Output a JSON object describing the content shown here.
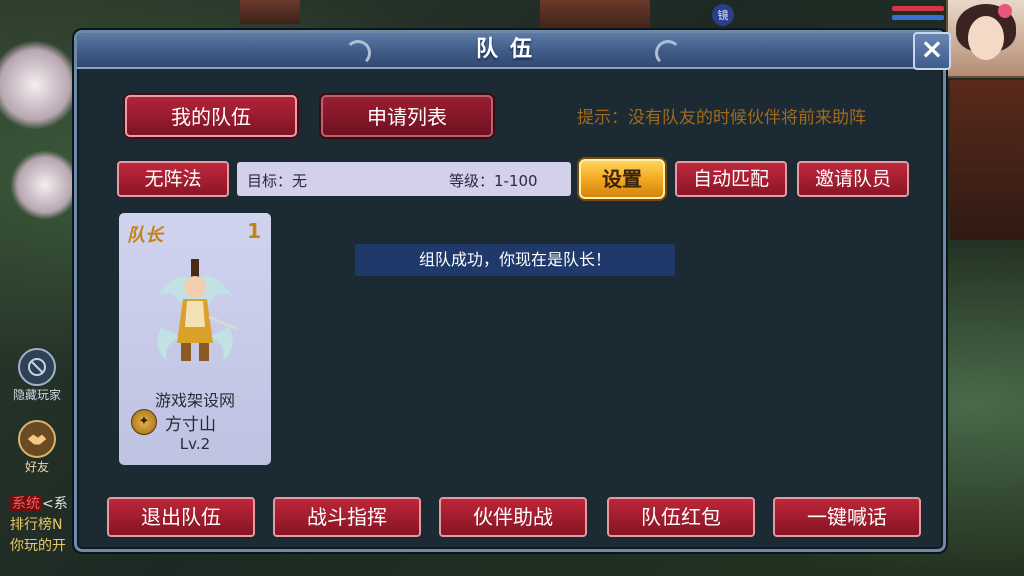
{
  "dialog": {
    "title": "队伍"
  },
  "tabs": [
    {
      "label": "我的队伍",
      "active": true
    },
    {
      "label": "申请列表",
      "active": false
    }
  ],
  "hint": "提示：没有队友的时候伙伴将前来助阵",
  "toolbar": {
    "formation": "无阵法",
    "target": "目标：无",
    "level": "等级：1-100",
    "settings": "设置",
    "auto_match": "自动匹配",
    "invite": "邀请队员"
  },
  "member": {
    "role": "队长",
    "slot": "1",
    "name": "游戏架设网",
    "school": "方寸山",
    "level": "Lv.2"
  },
  "toast": "组队成功，你现在是队长！",
  "bottom_actions": [
    "退出队伍",
    "战斗指挥",
    "伙伴助战",
    "队伍红包",
    "一键喊话"
  ],
  "hud": {
    "hide_players": "隐藏玩家",
    "friends": "好友",
    "top_badge": "镜",
    "chat": [
      {
        "channel": "系统",
        "text": "<系"
      },
      {
        "channel": "",
        "text": "排行榜N"
      },
      {
        "channel": "",
        "text": "你玩的开"
      }
    ]
  },
  "colors": {
    "accent_red": "#b3233a",
    "gold": "#f0a51c",
    "hint": "#a06a1e",
    "toast_bg": "#1f3a6a",
    "card_bg": "#c8cbe8"
  }
}
